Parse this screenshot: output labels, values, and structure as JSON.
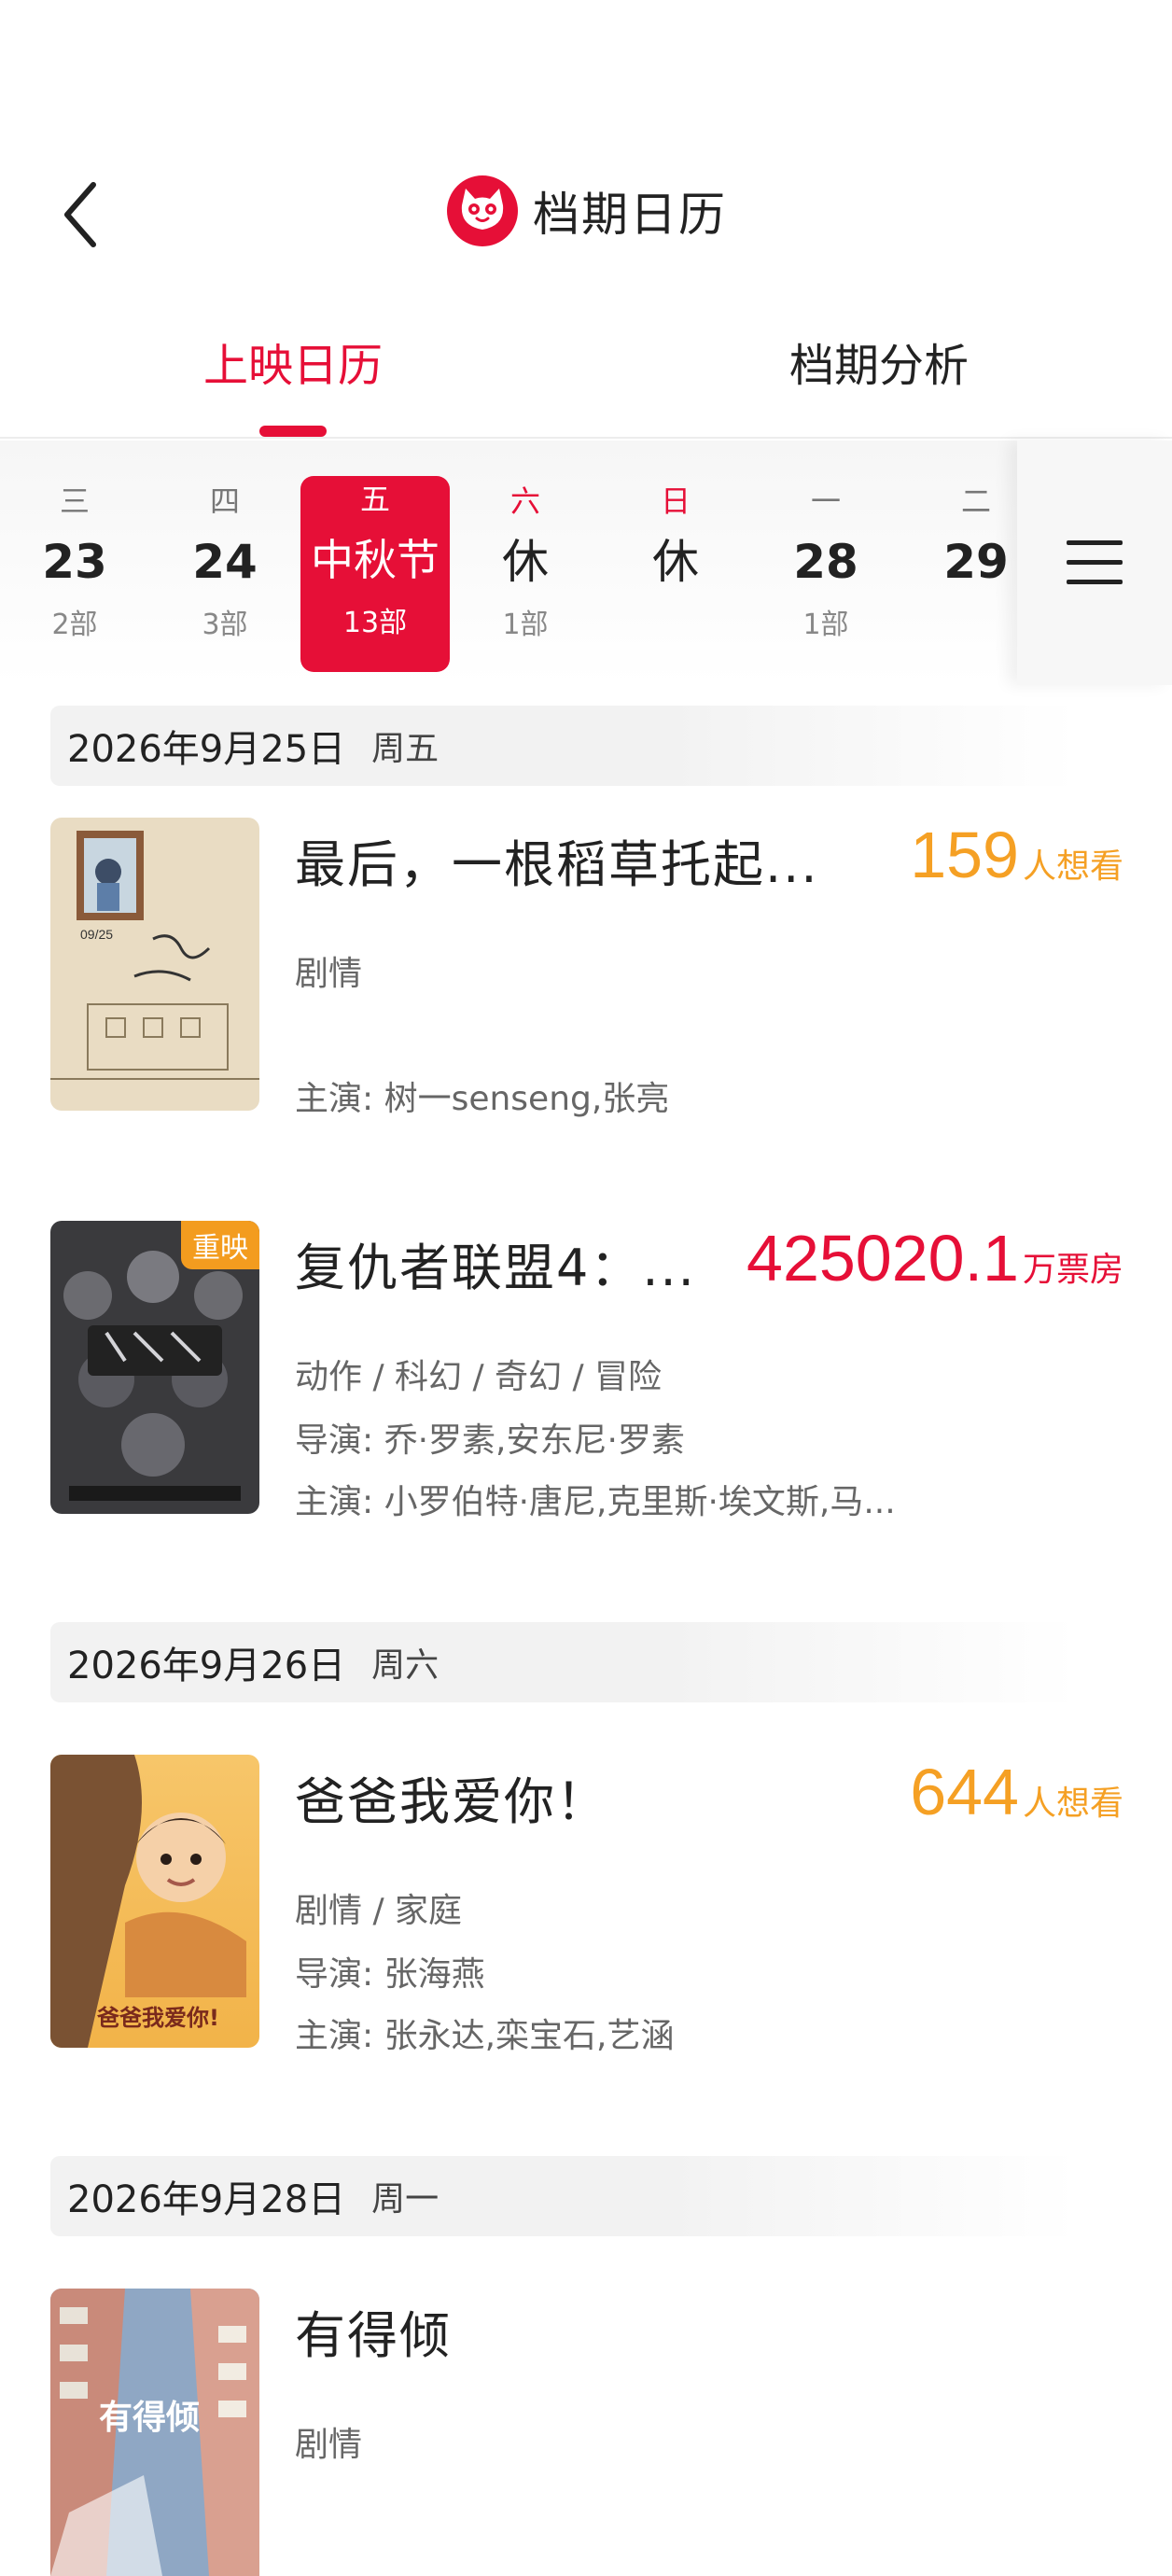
{
  "header": {
    "title": "档期日历",
    "tabs": [
      {
        "label": "上映日历",
        "active": true
      },
      {
        "label": "档期分析",
        "active": false
      }
    ]
  },
  "date_strip": {
    "days": [
      {
        "week": "三",
        "date": "23",
        "count": "2部"
      },
      {
        "week": "四",
        "date": "24",
        "count": "3部"
      },
      {
        "week": "五",
        "date": "中秋节",
        "count": "13部",
        "selected": true
      },
      {
        "week": "六",
        "date": "休",
        "count": "1部",
        "weekend": true
      },
      {
        "week": "日",
        "date": "休",
        "count": "",
        "weekend": true
      },
      {
        "week": "一",
        "date": "28",
        "count": "1部"
      },
      {
        "week": "二",
        "date": "29",
        "count": ""
      }
    ]
  },
  "sections": [
    {
      "date": "2026年9月25日",
      "weekday": "周五",
      "movies": [
        {
          "title": "最后，一根稻草托起...",
          "stat_value": "159",
          "stat_unit": "人想看",
          "genre": "剧情",
          "cast": "主演: 树一senseng,张亮"
        },
        {
          "title": "复仇者联盟4：...",
          "badge": "重映",
          "stat_value": "425020.1",
          "stat_unit": "万票房",
          "genre": "动作 / 科幻 / 奇幻 / 冒险",
          "director": "导演: 乔·罗素,安东尼·罗素",
          "cast": "主演: 小罗伯特·唐尼,克里斯·埃文斯,马..."
        }
      ]
    },
    {
      "date": "2026年9月26日",
      "weekday": "周六",
      "movies": [
        {
          "title": "爸爸我爱你！",
          "stat_value": "644",
          "stat_unit": "人想看",
          "genre": "剧情 / 家庭",
          "director": "导演: 张海燕",
          "cast": "主演: 张永达,栾宝石,艺涵"
        }
      ]
    },
    {
      "date": "2026年9月28日",
      "weekday": "周一",
      "movies": [
        {
          "title": "有得倾",
          "genre": "剧情"
        }
      ]
    }
  ],
  "colors": {
    "brand_red": "#e60f37",
    "want_orange": "#f5a024",
    "badge_orange": "#f39c1f"
  },
  "icons": {
    "back": "chevron-left-icon",
    "logo": "maoyan-cat-logo",
    "menu": "hamburger-menu-icon"
  }
}
